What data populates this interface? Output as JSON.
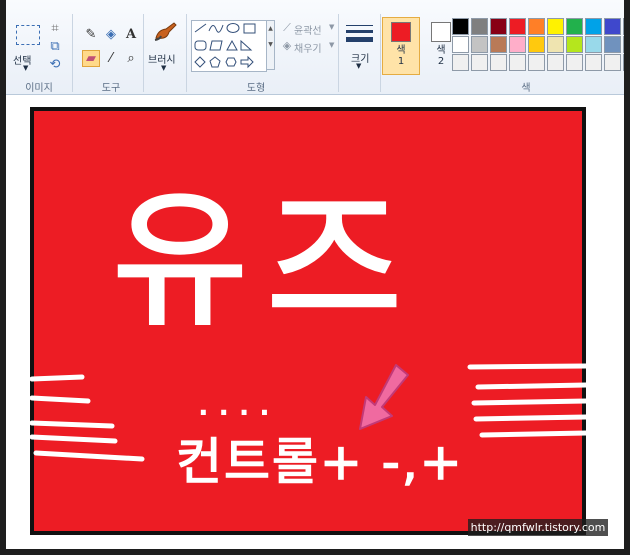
{
  "ribbon": {
    "groups": {
      "image": "이미지",
      "tools": "도구",
      "brush": "브러시",
      "shapes": "도형",
      "colors": "색"
    },
    "select_label": "선택",
    "size_label": "크기",
    "outline_label": "윤곽선",
    "fill_label": "채우기",
    "color1_label": "색\n1",
    "color2_label": "색\n2",
    "color1_value": "#ed1c24",
    "color2_value": "#ffffff",
    "palette": [
      "#000000",
      "#7f7f7f",
      "#880015",
      "#ed1c24",
      "#ff7f27",
      "#fff200",
      "#22b14c",
      "#00a2e8",
      "#3f48cc",
      "#a349a4",
      "#ffffff",
      "#c3c3c3",
      "#b97a57",
      "#ffaec9",
      "#ffc90e",
      "#efe4b0",
      "#b5e61d",
      "#99d9ea",
      "#7092be",
      "#c8bfe7",
      "#f0f0f0",
      "#f0f0f0",
      "#f0f0f0",
      "#f0f0f0",
      "#f0f0f0",
      "#f0f0f0",
      "#f0f0f0",
      "#f0f0f0",
      "#f0f0f0",
      "#f0f0f0"
    ]
  },
  "drawing": {
    "headline": "유즈",
    "dots": ". . . .",
    "instruction": "컨트롤+ -,+",
    "canvas_color": "#ed1c24",
    "arrow_color": "#f06aa0"
  },
  "watermark": "http://qmfwlr.tistory.com"
}
